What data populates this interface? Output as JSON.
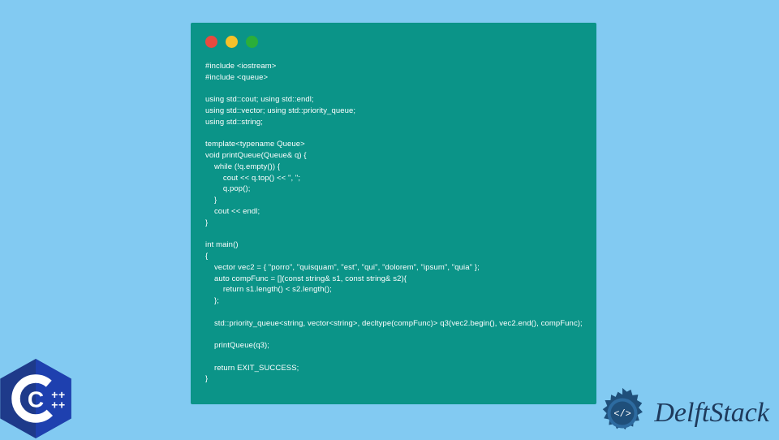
{
  "code": {
    "text": "#include <iostream>\n#include <queue>\n\nusing std::cout; using std::endl;\nusing std::vector; using std::priority_queue;\nusing std::string;\n\ntemplate<typename Queue>\nvoid printQueue(Queue& q) {\n    while (!q.empty()) {\n        cout << q.top() << \", \";\n        q.pop();\n    }\n    cout << endl;\n}\n\nint main()\n{\n    vector vec2 = { \"porro\", \"quisquam\", \"est\", \"qui\", \"dolorem\", \"ipsum\", \"quia\" };\n    auto compFunc = [](const string& s1, const string& s2){\n        return s1.length() < s2.length();\n    };\n\n    std::priority_queue<string, vector<string>, decltype(compFunc)> q3(vec2.begin(), vec2.end(), compFunc);\n\n    printQueue(q3);\n\n    return EXIT_SUCCESS;\n}"
  },
  "window": {
    "dots": {
      "red": "#e84a3f",
      "yellow": "#f6c12a",
      "green": "#2bae3a"
    }
  },
  "brand": {
    "name": "DelftStack"
  },
  "cpp_label": "C++"
}
